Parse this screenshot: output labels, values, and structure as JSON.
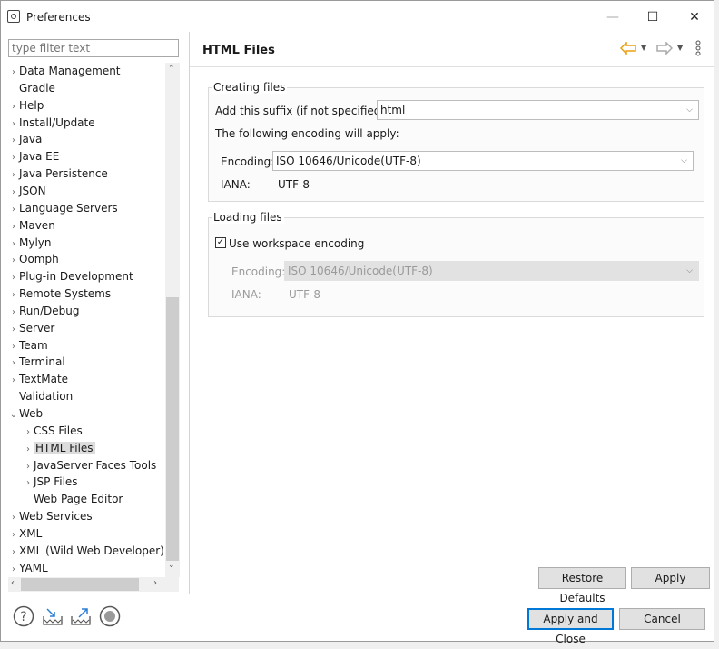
{
  "window": {
    "title": "Preferences",
    "minimize": "—",
    "maximize": "☐",
    "close": "✕"
  },
  "filter": {
    "placeholder": "type filter text"
  },
  "tree": [
    {
      "label": "Data Management",
      "arrow": "›",
      "indent": 0
    },
    {
      "label": "Gradle",
      "arrow": "",
      "indent": 0
    },
    {
      "label": "Help",
      "arrow": "›",
      "indent": 0
    },
    {
      "label": "Install/Update",
      "arrow": "›",
      "indent": 0
    },
    {
      "label": "Java",
      "arrow": "›",
      "indent": 0
    },
    {
      "label": "Java EE",
      "arrow": "›",
      "indent": 0
    },
    {
      "label": "Java Persistence",
      "arrow": "›",
      "indent": 0
    },
    {
      "label": "JSON",
      "arrow": "›",
      "indent": 0
    },
    {
      "label": "Language Servers",
      "arrow": "›",
      "indent": 0
    },
    {
      "label": "Maven",
      "arrow": "›",
      "indent": 0
    },
    {
      "label": "Mylyn",
      "arrow": "›",
      "indent": 0
    },
    {
      "label": "Oomph",
      "arrow": "›",
      "indent": 0
    },
    {
      "label": "Plug-in Development",
      "arrow": "›",
      "indent": 0
    },
    {
      "label": "Remote Systems",
      "arrow": "›",
      "indent": 0
    },
    {
      "label": "Run/Debug",
      "arrow": "›",
      "indent": 0
    },
    {
      "label": "Server",
      "arrow": "›",
      "indent": 0
    },
    {
      "label": "Team",
      "arrow": "›",
      "indent": 0
    },
    {
      "label": "Terminal",
      "arrow": "›",
      "indent": 0
    },
    {
      "label": "TextMate",
      "arrow": "›",
      "indent": 0
    },
    {
      "label": "Validation",
      "arrow": "",
      "indent": 0
    },
    {
      "label": "Web",
      "arrow": "⌄",
      "indent": 0
    },
    {
      "label": "CSS Files",
      "arrow": "›",
      "indent": 1
    },
    {
      "label": "HTML Files",
      "arrow": "›",
      "indent": 1,
      "selected": true
    },
    {
      "label": "JavaServer Faces Tools",
      "arrow": "›",
      "indent": 1
    },
    {
      "label": "JSP Files",
      "arrow": "›",
      "indent": 1
    },
    {
      "label": "Web Page Editor",
      "arrow": "",
      "indent": 1
    },
    {
      "label": "Web Services",
      "arrow": "›",
      "indent": 0
    },
    {
      "label": "XML",
      "arrow": "›",
      "indent": 0
    },
    {
      "label": "XML (Wild Web Developer)",
      "arrow": "›",
      "indent": 0
    },
    {
      "label": "YAML",
      "arrow": "›",
      "indent": 0
    }
  ],
  "page": {
    "title": "HTML Files",
    "creating": {
      "group_label": "Creating files",
      "suffix_label": "Add this suffix (if not specified):",
      "suffix_value": "html",
      "encoding_note": "The following encoding will apply:",
      "encoding_label": "Encoding:",
      "encoding_value": "ISO 10646/Unicode(UTF-8)",
      "iana_label": "IANA:",
      "iana_value": "UTF-8"
    },
    "loading": {
      "group_label": "Loading files",
      "use_workspace_label": "Use workspace encoding",
      "use_workspace_checked": true,
      "encoding_label": "Encoding:",
      "encoding_value": "ISO 10646/Unicode(UTF-8)",
      "iana_label": "IANA:",
      "iana_value": "UTF-8"
    },
    "restore_defaults": "Restore Defaults",
    "apply": "Apply"
  },
  "footer": {
    "apply_close": "Apply and Close",
    "cancel": "Cancel",
    "icons": [
      "help-icon",
      "import-icon",
      "export-icon",
      "record-icon"
    ]
  },
  "colors": {
    "accent": "#0078d7",
    "back_arrow": "#e8a010"
  }
}
